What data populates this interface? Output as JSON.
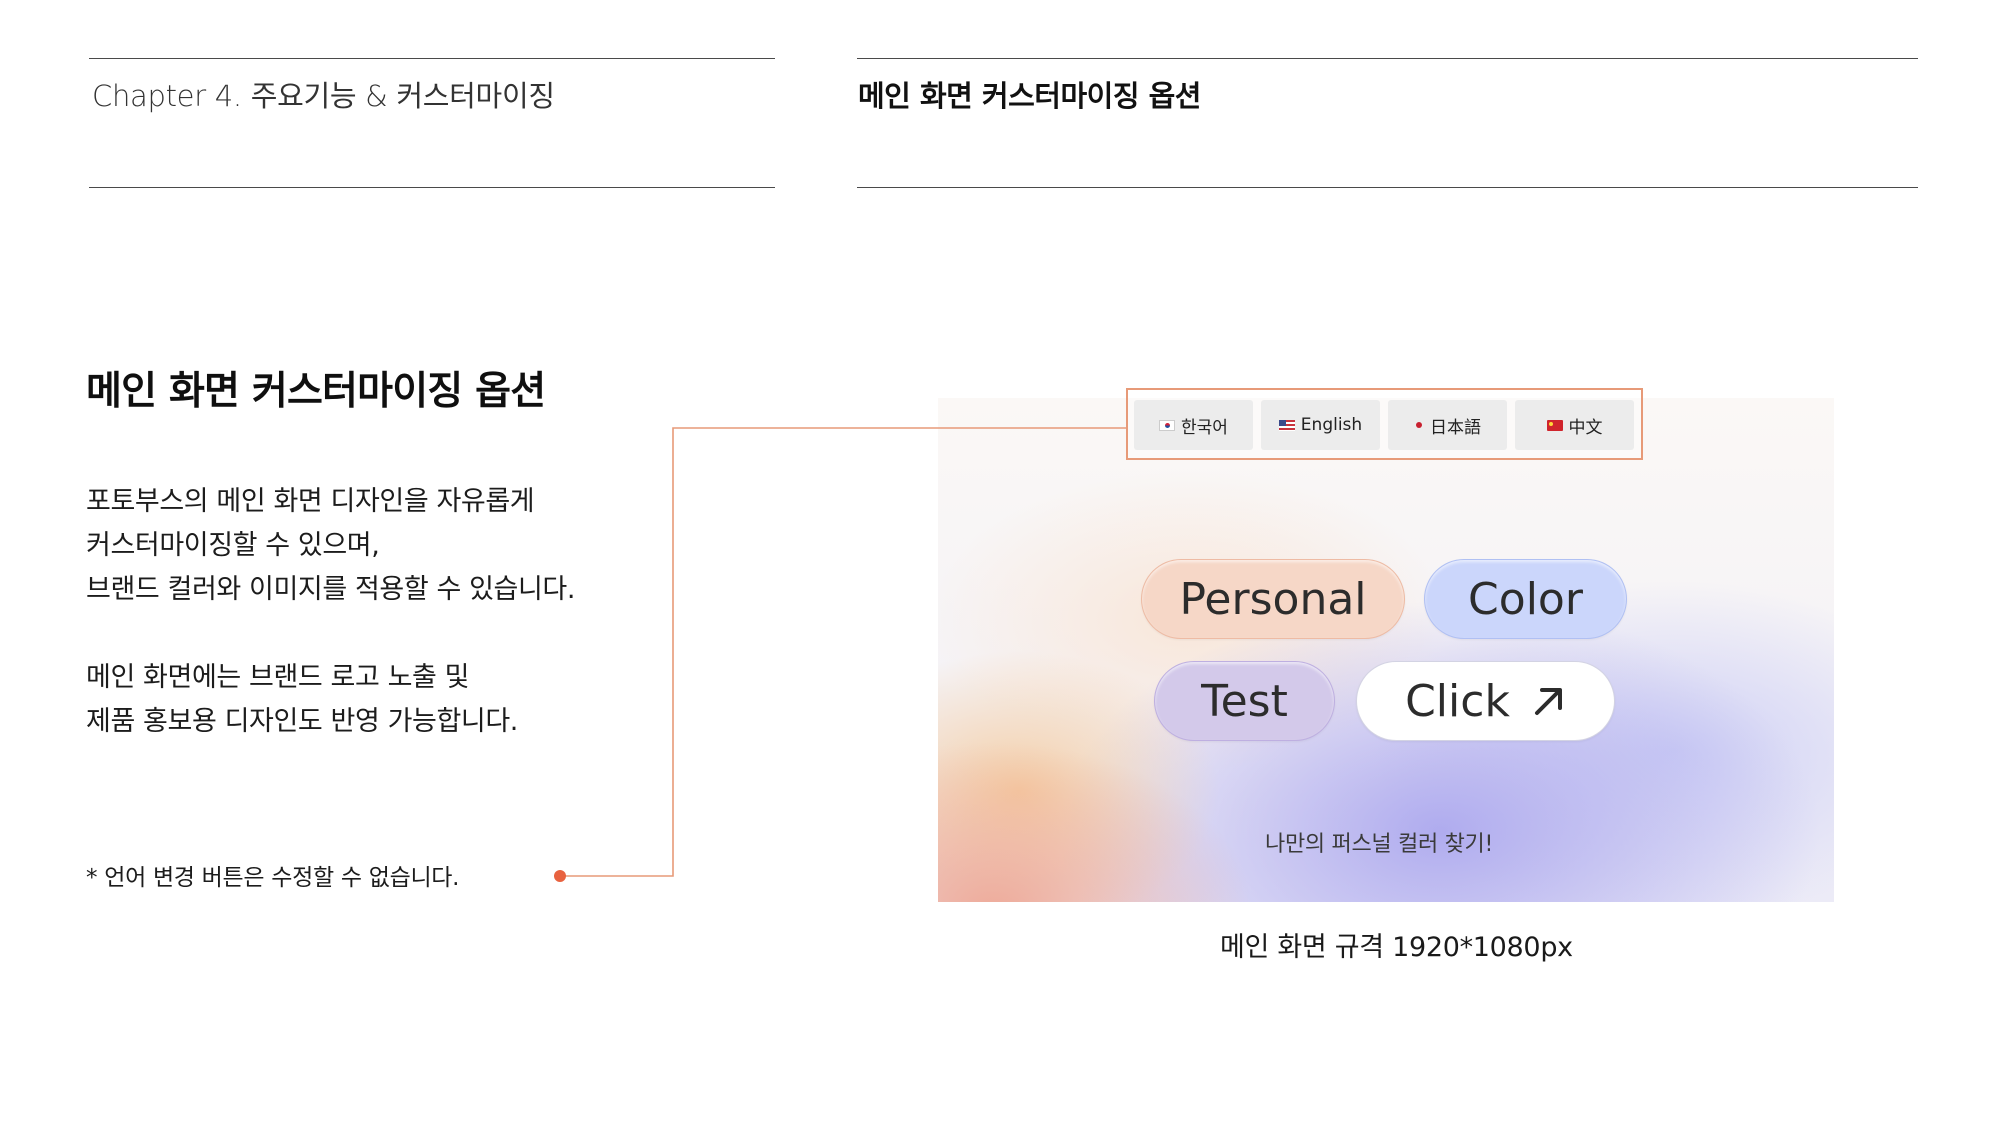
{
  "header": {
    "chapter": "Chapter 4. 주요기능 & 커스터마이징",
    "section": "메인 화면 커스터마이징 옵션"
  },
  "content": {
    "title": "메인 화면 커스터마이징 옵션",
    "description_lines": [
      "포토부스의 메인 화면 디자인을 자유롭게",
      "커스터마이징할 수 있으며,",
      "브랜드 컬러와 이미지를 적용할 수 있습니다.",
      "메인 화면에는 브랜드 로고 노출 및",
      "제품 홍보용 디자인도 반영 가능합니다."
    ],
    "note": "* 언어 변경 버튼은 수정할 수 없습니다."
  },
  "preview": {
    "languages": [
      {
        "label": "한국어",
        "icon": "kr-flag-icon"
      },
      {
        "label": "English",
        "icon": "us-flag-icon"
      },
      {
        "label": "日本語",
        "icon": "jp-flag-icon"
      },
      {
        "label": "中文",
        "icon": "cn-flag-icon"
      }
    ],
    "pills": {
      "personal": "Personal",
      "color": "Color",
      "test": "Test",
      "click": "Click"
    },
    "tagline": "나만의 퍼스널 컬러 찾기!",
    "caption": "메인 화면 규격 1920*1080px"
  },
  "colors": {
    "accent_line": "#e79a78",
    "accent_dot": "#e8623f",
    "pill_personal": "#f6d7c7",
    "pill_color": "#cbd6fb",
    "pill_test": "#d3c9ea",
    "pill_click": "#ffffff"
  }
}
